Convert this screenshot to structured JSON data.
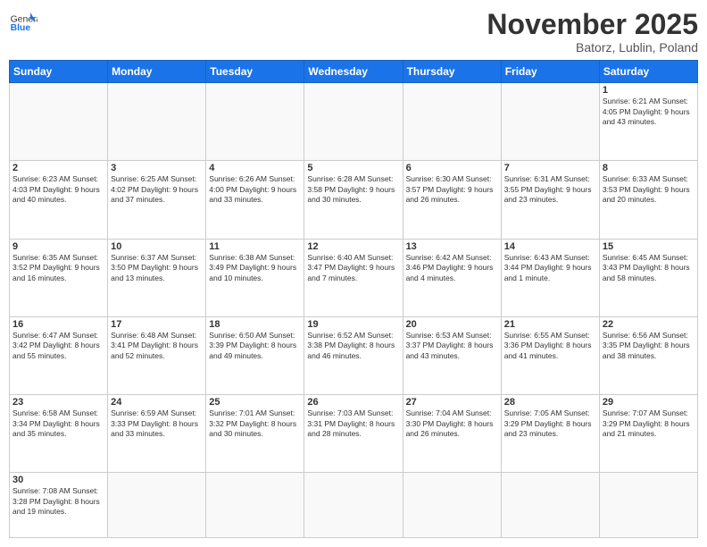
{
  "header": {
    "logo_general": "General",
    "logo_blue": "Blue",
    "month": "November 2025",
    "location": "Batorz, Lublin, Poland"
  },
  "weekdays": [
    "Sunday",
    "Monday",
    "Tuesday",
    "Wednesday",
    "Thursday",
    "Friday",
    "Saturday"
  ],
  "days": [
    {
      "num": "",
      "info": ""
    },
    {
      "num": "",
      "info": ""
    },
    {
      "num": "",
      "info": ""
    },
    {
      "num": "",
      "info": ""
    },
    {
      "num": "",
      "info": ""
    },
    {
      "num": "",
      "info": ""
    },
    {
      "num": "1",
      "info": "Sunrise: 6:21 AM\nSunset: 4:05 PM\nDaylight: 9 hours\nand 43 minutes."
    },
    {
      "num": "2",
      "info": "Sunrise: 6:23 AM\nSunset: 4:03 PM\nDaylight: 9 hours\nand 40 minutes."
    },
    {
      "num": "3",
      "info": "Sunrise: 6:25 AM\nSunset: 4:02 PM\nDaylight: 9 hours\nand 37 minutes."
    },
    {
      "num": "4",
      "info": "Sunrise: 6:26 AM\nSunset: 4:00 PM\nDaylight: 9 hours\nand 33 minutes."
    },
    {
      "num": "5",
      "info": "Sunrise: 6:28 AM\nSunset: 3:58 PM\nDaylight: 9 hours\nand 30 minutes."
    },
    {
      "num": "6",
      "info": "Sunrise: 6:30 AM\nSunset: 3:57 PM\nDaylight: 9 hours\nand 26 minutes."
    },
    {
      "num": "7",
      "info": "Sunrise: 6:31 AM\nSunset: 3:55 PM\nDaylight: 9 hours\nand 23 minutes."
    },
    {
      "num": "8",
      "info": "Sunrise: 6:33 AM\nSunset: 3:53 PM\nDaylight: 9 hours\nand 20 minutes."
    },
    {
      "num": "9",
      "info": "Sunrise: 6:35 AM\nSunset: 3:52 PM\nDaylight: 9 hours\nand 16 minutes."
    },
    {
      "num": "10",
      "info": "Sunrise: 6:37 AM\nSunset: 3:50 PM\nDaylight: 9 hours\nand 13 minutes."
    },
    {
      "num": "11",
      "info": "Sunrise: 6:38 AM\nSunset: 3:49 PM\nDaylight: 9 hours\nand 10 minutes."
    },
    {
      "num": "12",
      "info": "Sunrise: 6:40 AM\nSunset: 3:47 PM\nDaylight: 9 hours\nand 7 minutes."
    },
    {
      "num": "13",
      "info": "Sunrise: 6:42 AM\nSunset: 3:46 PM\nDaylight: 9 hours\nand 4 minutes."
    },
    {
      "num": "14",
      "info": "Sunrise: 6:43 AM\nSunset: 3:44 PM\nDaylight: 9 hours\nand 1 minute."
    },
    {
      "num": "15",
      "info": "Sunrise: 6:45 AM\nSunset: 3:43 PM\nDaylight: 8 hours\nand 58 minutes."
    },
    {
      "num": "16",
      "info": "Sunrise: 6:47 AM\nSunset: 3:42 PM\nDaylight: 8 hours\nand 55 minutes."
    },
    {
      "num": "17",
      "info": "Sunrise: 6:48 AM\nSunset: 3:41 PM\nDaylight: 8 hours\nand 52 minutes."
    },
    {
      "num": "18",
      "info": "Sunrise: 6:50 AM\nSunset: 3:39 PM\nDaylight: 8 hours\nand 49 minutes."
    },
    {
      "num": "19",
      "info": "Sunrise: 6:52 AM\nSunset: 3:38 PM\nDaylight: 8 hours\nand 46 minutes."
    },
    {
      "num": "20",
      "info": "Sunrise: 6:53 AM\nSunset: 3:37 PM\nDaylight: 8 hours\nand 43 minutes."
    },
    {
      "num": "21",
      "info": "Sunrise: 6:55 AM\nSunset: 3:36 PM\nDaylight: 8 hours\nand 41 minutes."
    },
    {
      "num": "22",
      "info": "Sunrise: 6:56 AM\nSunset: 3:35 PM\nDaylight: 8 hours\nand 38 minutes."
    },
    {
      "num": "23",
      "info": "Sunrise: 6:58 AM\nSunset: 3:34 PM\nDaylight: 8 hours\nand 35 minutes."
    },
    {
      "num": "24",
      "info": "Sunrise: 6:59 AM\nSunset: 3:33 PM\nDaylight: 8 hours\nand 33 minutes."
    },
    {
      "num": "25",
      "info": "Sunrise: 7:01 AM\nSunset: 3:32 PM\nDaylight: 8 hours\nand 30 minutes."
    },
    {
      "num": "26",
      "info": "Sunrise: 7:03 AM\nSunset: 3:31 PM\nDaylight: 8 hours\nand 28 minutes."
    },
    {
      "num": "27",
      "info": "Sunrise: 7:04 AM\nSunset: 3:30 PM\nDaylight: 8 hours\nand 26 minutes."
    },
    {
      "num": "28",
      "info": "Sunrise: 7:05 AM\nSunset: 3:29 PM\nDaylight: 8 hours\nand 23 minutes."
    },
    {
      "num": "29",
      "info": "Sunrise: 7:07 AM\nSunset: 3:29 PM\nDaylight: 8 hours\nand 21 minutes."
    },
    {
      "num": "30",
      "info": "Sunrise: 7:08 AM\nSunset: 3:28 PM\nDaylight: 8 hours\nand 19 minutes."
    }
  ]
}
